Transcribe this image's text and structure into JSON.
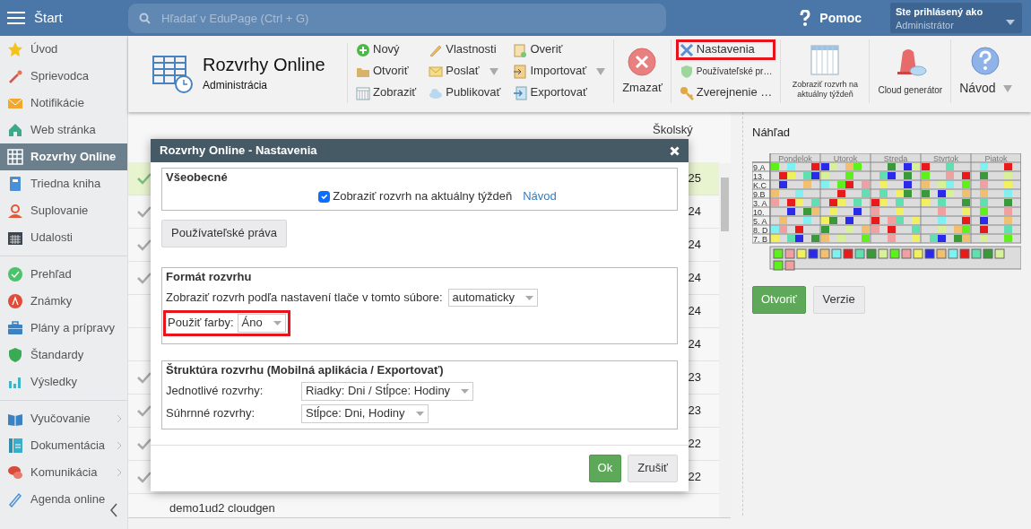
{
  "topbar": {
    "menu_label": "Štart",
    "search": {
      "placeholder": "Hľadať v EduPage (Ctrl + G)"
    },
    "help": "Pomoc",
    "user": {
      "caption": "Ste prihlásený ako",
      "name": "Administrátor"
    }
  },
  "sidebar": {
    "groups": [
      {
        "items": [
          {
            "label": "Úvod",
            "selected": false,
            "has_submenu": false
          },
          {
            "label": "Sprievodca",
            "selected": false,
            "has_submenu": false
          },
          {
            "label": "Notifikácie",
            "selected": false,
            "has_submenu": false
          },
          {
            "label": "Web stránka",
            "selected": false,
            "has_submenu": false
          },
          {
            "label": "Rozvrhy Online",
            "selected": true,
            "has_submenu": false
          },
          {
            "label": "Triedna kniha",
            "selected": false,
            "has_submenu": false
          },
          {
            "label": "Suplovanie",
            "selected": false,
            "has_submenu": false
          },
          {
            "label": "Udalosti",
            "selected": false,
            "has_submenu": false
          }
        ]
      },
      {
        "items": [
          {
            "label": "Prehľad",
            "selected": false,
            "has_submenu": false
          },
          {
            "label": "Známky",
            "selected": false,
            "has_submenu": false
          },
          {
            "label": "Plány a prípravy",
            "selected": false,
            "has_submenu": false
          },
          {
            "label": "Štandardy",
            "selected": false,
            "has_submenu": false
          },
          {
            "label": "Výsledky",
            "selected": false,
            "has_submenu": false
          }
        ]
      },
      {
        "items": [
          {
            "label": "Vyučovanie",
            "selected": false,
            "has_submenu": true
          },
          {
            "label": "Dokumentácia",
            "selected": false,
            "has_submenu": true
          },
          {
            "label": "Komunikácia",
            "selected": false,
            "has_submenu": true
          },
          {
            "label": "Agenda online",
            "selected": false,
            "has_submenu": false
          }
        ]
      }
    ]
  },
  "ribbon": {
    "title": "Rozvrhy Online",
    "subtitle": "Administrácia",
    "groups": [
      {
        "kind": "small",
        "columns": [
          [
            {
              "label": "Nový",
              "dropdown": false,
              "highlighted": false
            },
            {
              "label": "Otvoriť",
              "dropdown": false,
              "highlighted": false
            },
            {
              "label": "Zobraziť",
              "dropdown": false,
              "highlighted": false
            }
          ],
          [
            {
              "label": "Vlastnosti",
              "dropdown": false,
              "highlighted": false
            },
            {
              "label": "Poslať",
              "dropdown": true,
              "highlighted": false
            },
            {
              "label": "Publikovať",
              "dropdown": false,
              "highlighted": false
            }
          ],
          [
            {
              "label": "Overiť",
              "dropdown": false,
              "highlighted": false
            },
            {
              "label": "Importovať",
              "dropdown": true,
              "highlighted": false
            },
            {
              "label": "Exportovať",
              "dropdown": false,
              "highlighted": false
            }
          ]
        ]
      },
      {
        "kind": "large",
        "label": "Zmazať",
        "dropdown": false
      },
      {
        "kind": "small",
        "columns": [
          [
            {
              "label": "Nastavenia",
              "dropdown": false,
              "highlighted": true
            },
            {
              "label": "Používateľské pr…",
              "dropdown": false,
              "highlighted": false
            },
            {
              "label": "Zverejnenie …",
              "dropdown": false,
              "highlighted": false
            }
          ]
        ]
      },
      {
        "kind": "large",
        "label": "Zobraziť rozvrh na aktuálny týždeň",
        "dropdown": false
      },
      {
        "kind": "large",
        "label": "Cloud generátor",
        "dropdown": false
      },
      {
        "kind": "large",
        "label": "Návod",
        "dropdown": true
      }
    ]
  },
  "table": {
    "columns": [
      "Školský"
    ],
    "rows": [
      {
        "checked": true,
        "selected": true,
        "school_year": "25"
      },
      {
        "checked": true,
        "selected": false,
        "school_year": "24"
      },
      {
        "checked": true,
        "selected": false,
        "school_year": "24"
      },
      {
        "checked": true,
        "selected": false,
        "school_year": "24"
      },
      {
        "checked": false,
        "selected": false,
        "school_year": "24"
      },
      {
        "checked": false,
        "selected": false,
        "school_year": "24"
      },
      {
        "checked": true,
        "selected": false,
        "school_year": "23"
      },
      {
        "checked": true,
        "selected": false,
        "school_year": "23"
      },
      {
        "checked": true,
        "selected": false,
        "school_year": "22"
      },
      {
        "checked": true,
        "selected": false,
        "school_year": "22"
      },
      {
        "checked": false,
        "selected": false,
        "name": "demo1ud2 cloudgen"
      }
    ]
  },
  "preview": {
    "title": "Náhľad",
    "days": [
      "Pondelok",
      "Utorok",
      "Streda",
      "Stvrtok",
      "Piatok"
    ],
    "classes": [
      "9.A",
      "13.",
      "K.C",
      "9.B",
      "3. A",
      "10.",
      "5. A",
      "8. D",
      "7. B"
    ],
    "buttons": [
      {
        "label": "Otvoriť",
        "kind": "primary"
      },
      {
        "label": "Verzie",
        "kind": "secondary"
      }
    ]
  },
  "modal": {
    "title": "Rozvrhy Online - Nastavenia",
    "general": {
      "legend": "Všeobecné",
      "checkbox": {
        "label": "Zobraziť rozvrh na aktuálny týždeň",
        "checked": true
      },
      "link": "Návod"
    },
    "rights_button": "Používateľské práva",
    "format": {
      "legend": "Formát rozvrhu",
      "fields": [
        {
          "label": "Zobraziť rozvrh podľa nastavení tlače v tomto súbore:",
          "value": "automaticky",
          "highlighted": false
        },
        {
          "label": "Použiť farby:",
          "value": "Áno",
          "highlighted": true
        }
      ]
    },
    "structure": {
      "legend": "Štruktúra rozvrhu (Mobilná aplikácia / Exportovať)",
      "fields": [
        {
          "label": "Jednotlivé rozvrhy:",
          "value": "Riadky: Dni / Stĺpce: Hodiny",
          "highlighted": false
        },
        {
          "label": "Súhrnné rozvrhy:",
          "value": "Stĺpce: Dni, Hodiny",
          "highlighted": false
        }
      ]
    },
    "buttons": [
      {
        "label": "Ok",
        "kind": "primary"
      },
      {
        "label": "Zrušiť",
        "kind": "secondary"
      }
    ]
  }
}
